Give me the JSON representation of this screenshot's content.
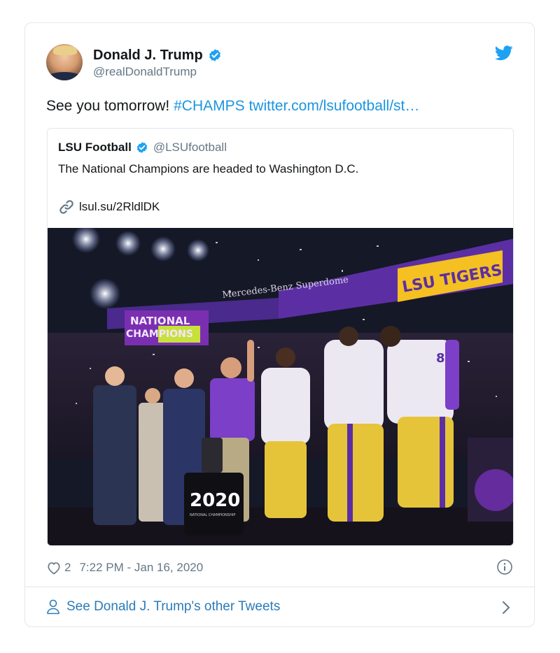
{
  "tweet": {
    "author_name": "Donald J. Trump",
    "author_handle": "@realDonaldTrump",
    "text_plain": "See you tomorrow! ",
    "text_hashtag": "#CHAMPS",
    "text_link": " twitter.com/lsufootball/st…",
    "likes": "2",
    "timestamp": "7:22 PM - Jan 16, 2020",
    "accent_color": "#1b95e0"
  },
  "quote": {
    "author_name": "LSU Football",
    "author_handle": "@LSUfootball",
    "text": "The National Champions are headed to Washington D.C.",
    "link": "lsul.su/2RldlDK"
  },
  "photo": {
    "arena_sign": "Mercedes-Benz Superdome",
    "banner_lsu": "LSU TIGERS",
    "banner_left_line1": "NATIONAL",
    "banner_left_line2": "CHAMPIONS",
    "podium_year": "2020",
    "podium_sub": "NATIONAL CHAMPIONSHIP",
    "jersey_number": "8"
  },
  "footer": {
    "label": "See Donald J. Trump's other Tweets"
  },
  "icons": [
    "twitter-bird-icon",
    "verified-badge-icon",
    "link-icon",
    "heart-icon",
    "info-icon",
    "person-icon",
    "chevron-right-icon"
  ]
}
